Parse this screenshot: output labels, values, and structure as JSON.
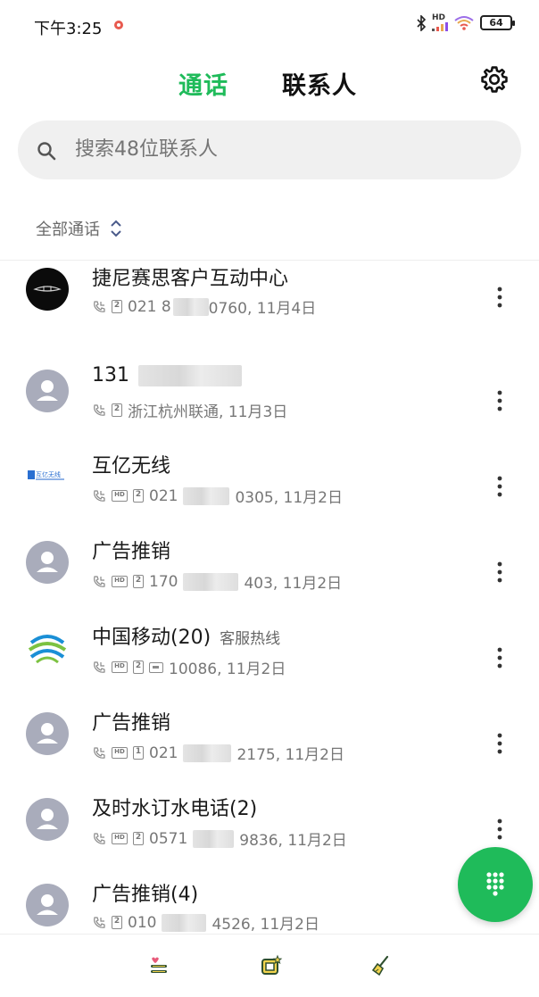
{
  "status_bar": {
    "time": "下午3:25",
    "hd": "HD",
    "battery": "64"
  },
  "header": {
    "tab_calls": "通话",
    "tab_contacts": "联系人",
    "accent_color": "#1fbb5a"
  },
  "search": {
    "placeholder": "搜索48位联系人"
  },
  "filter": {
    "label": "全部通话"
  },
  "calls": [
    {
      "name": "捷尼赛思客户互动中心",
      "tag": "",
      "number_start": "021 8",
      "number_end": "0760",
      "location": "",
      "date": "11月4日",
      "sim": "2",
      "hd": false
    },
    {
      "name": "131",
      "tag": "",
      "number_start": "",
      "number_end": "",
      "location": "浙江杭州联通",
      "date": "11月3日",
      "sim": "2",
      "hd": false
    },
    {
      "name": "互亿无线",
      "tag": "",
      "number_start": "021",
      "number_end": "0305",
      "location": "",
      "date": "11月2日",
      "sim": "2",
      "hd": true,
      "logo_text": "互亿无线"
    },
    {
      "name": "广告推销",
      "tag": "",
      "number_start": "170",
      "number_end": "403",
      "location": "",
      "date": "11月2日",
      "sim": "2",
      "hd": true
    },
    {
      "name": "中国移动(20)",
      "tag": "客服热线",
      "number_start": "10086",
      "number_end": "",
      "location": "",
      "date": "11月2日",
      "sim": "2",
      "hd": true
    },
    {
      "name": "广告推销",
      "tag": "",
      "number_start": "021",
      "number_end": "2175",
      "location": "",
      "date": "11月2日",
      "sim": "1",
      "hd": true
    },
    {
      "name": "及时水订水电话(2)",
      "tag": "",
      "number_start": "0571",
      "number_end": "9836",
      "location": "",
      "date": "11月2日",
      "sim": "2",
      "hd": true
    },
    {
      "name": "广告推销(4)",
      "tag": "",
      "number_start": "010",
      "number_end": "4526",
      "location": "",
      "date": "11月2日",
      "sim": "2",
      "hd": false
    }
  ]
}
